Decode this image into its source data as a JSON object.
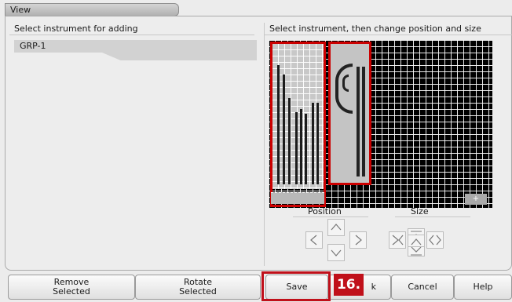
{
  "window": {
    "title": "View"
  },
  "left_panel": {
    "header": "Select instrument for adding",
    "items": [
      {
        "label": "GRP-1"
      }
    ]
  },
  "right_panel": {
    "header": "Select instrument, then change position and size"
  },
  "position": {
    "label": "Position"
  },
  "size": {
    "label": "Size"
  },
  "step_badge": "16.",
  "buttons": {
    "remove_line1": "Remove",
    "remove_line2": "Selected",
    "rotate_line1": "Rotate",
    "rotate_line2": "Selected",
    "save": "Save",
    "ok_fragment": "k",
    "cancel": "Cancel",
    "help": "Help"
  },
  "colors": {
    "highlight": "#c0101a",
    "selection": "#cc0000",
    "grid_bg": "#000000"
  }
}
